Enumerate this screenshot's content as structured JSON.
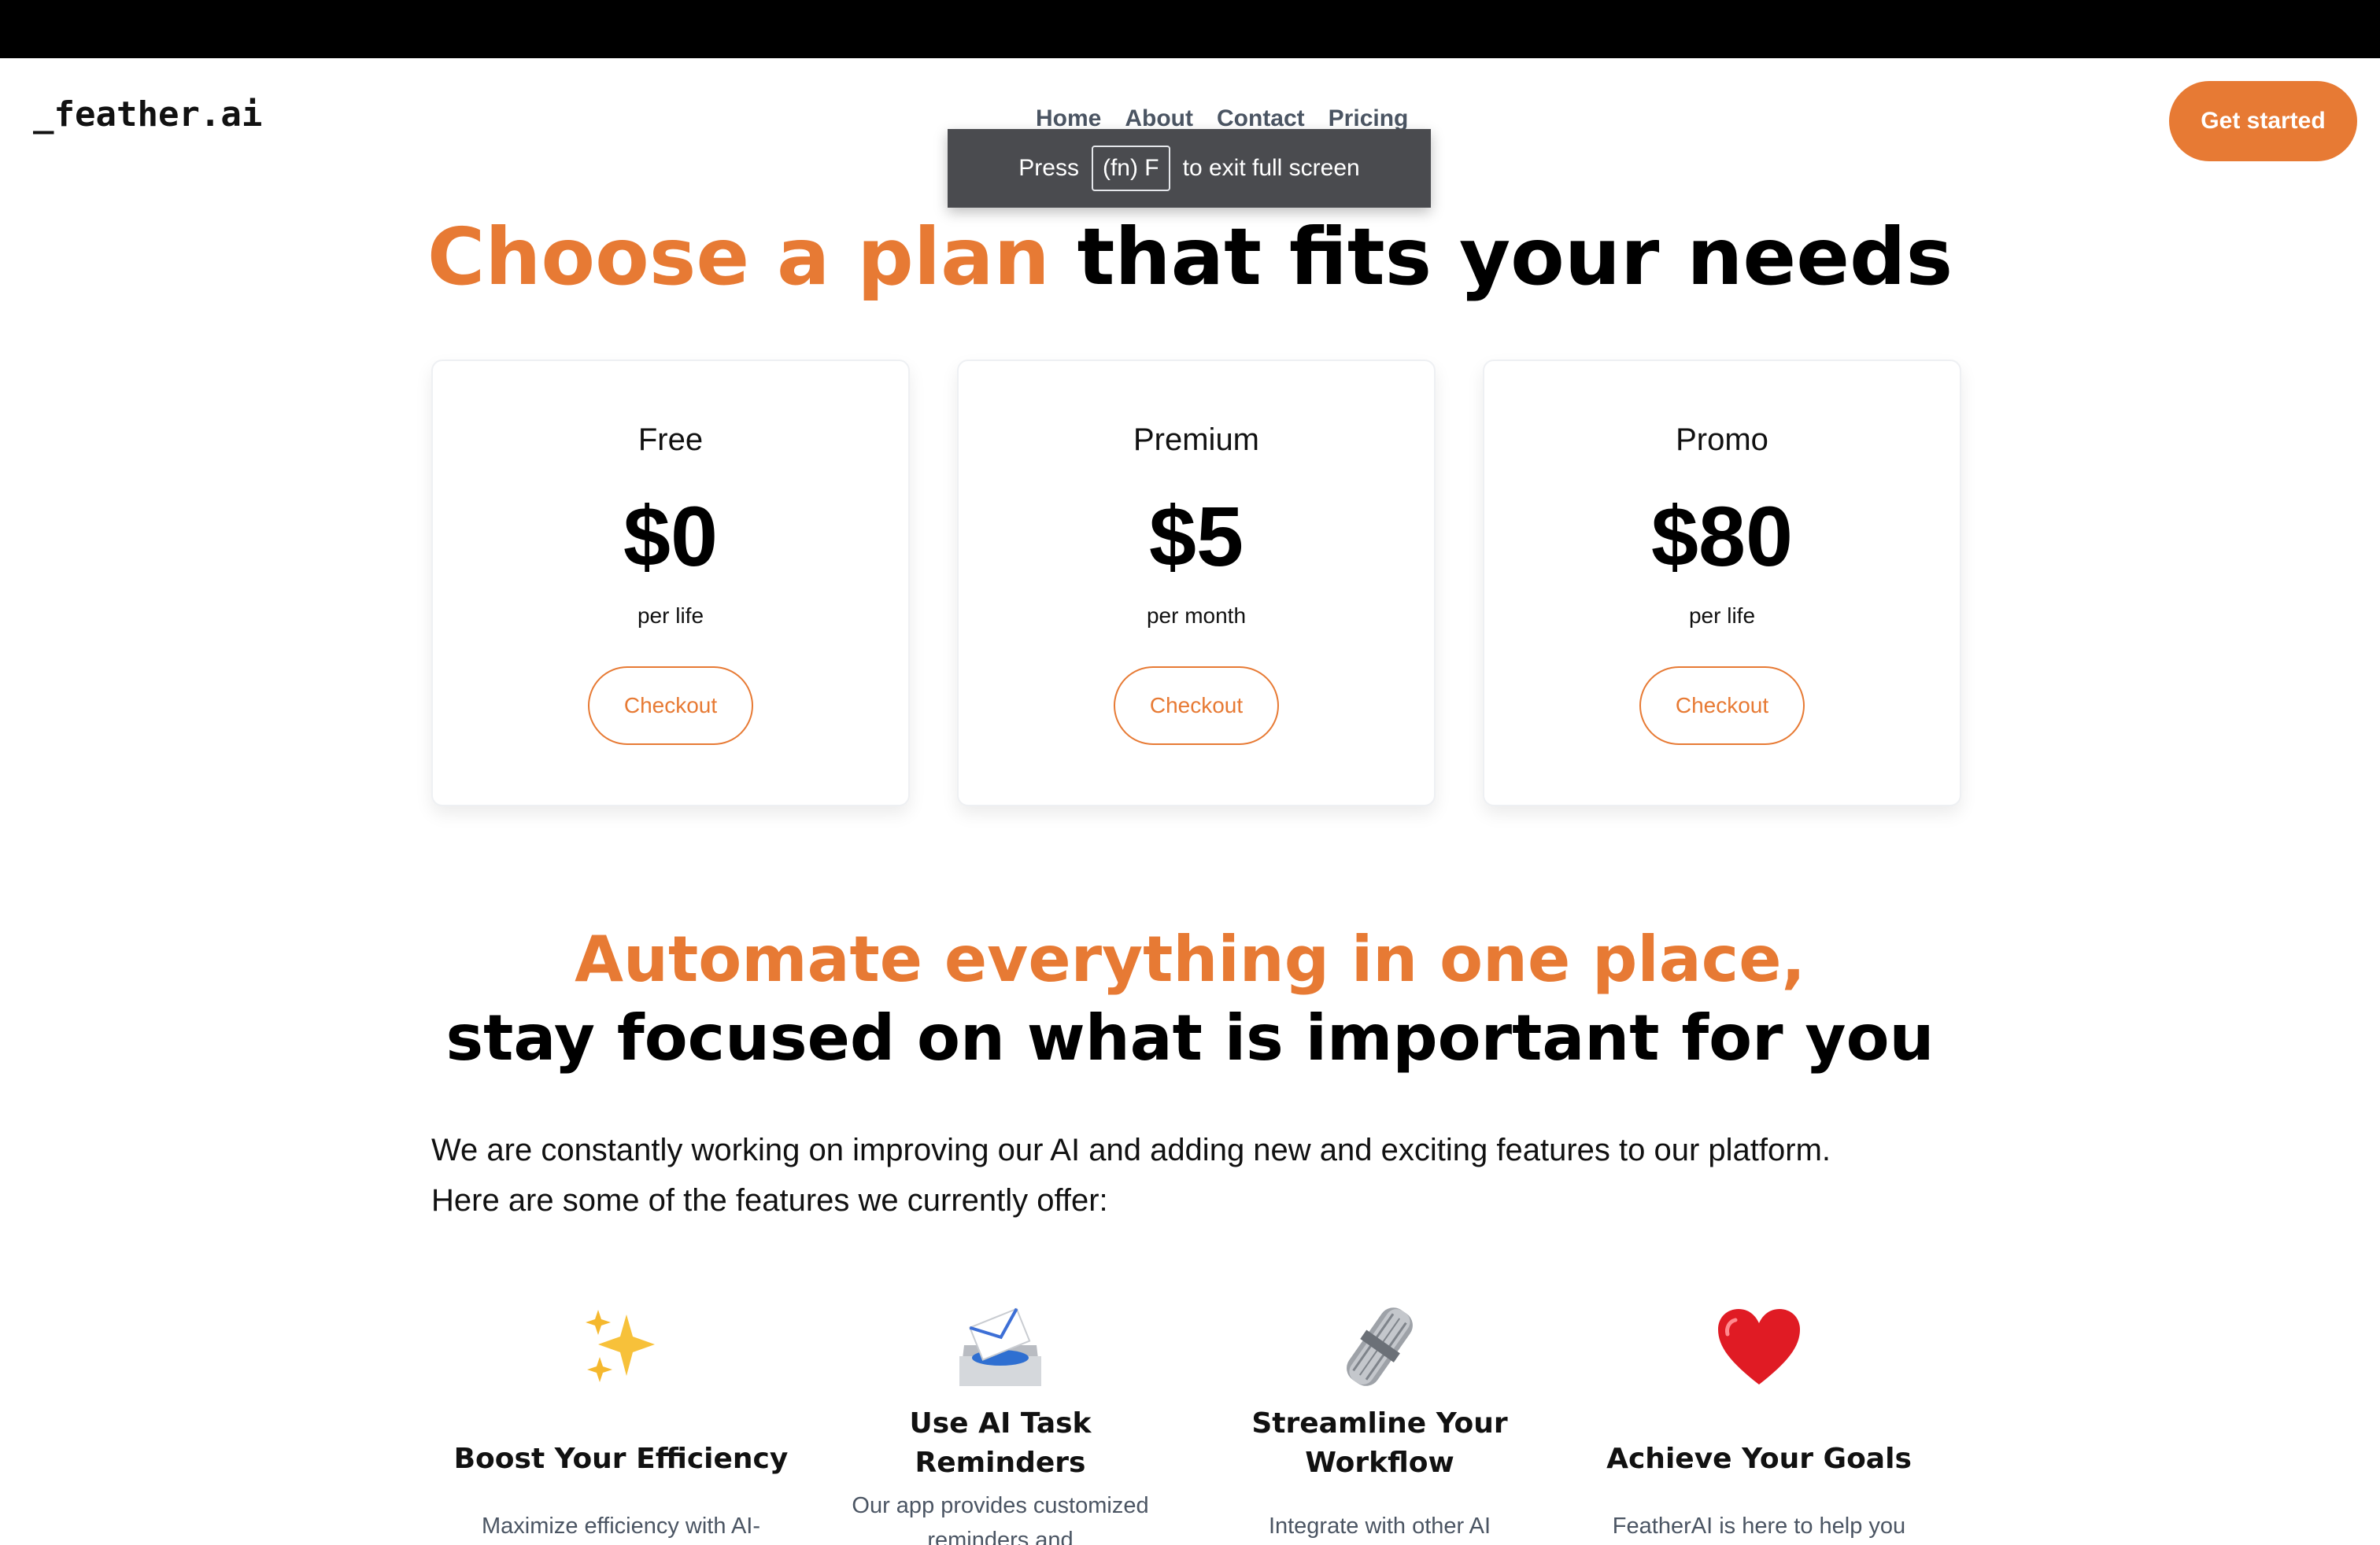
{
  "header": {
    "logo": "_feather.ai",
    "nav": [
      "Home",
      "About",
      "Contact",
      "Pricing"
    ],
    "cta": "Get started"
  },
  "fullscreen_toast": {
    "press": "Press",
    "key": "(fn) F",
    "suffix": "to exit full screen"
  },
  "pricing": {
    "title_accent": "Choose a plan",
    "title_rest": " that fits your needs",
    "plans": [
      {
        "name": "Free",
        "price": "$0",
        "period": "per life",
        "button": "Checkout"
      },
      {
        "name": "Premium",
        "price": "$5",
        "period": "per month",
        "button": "Checkout"
      },
      {
        "name": "Promo",
        "price": "$80",
        "period": "per life",
        "button": "Checkout"
      }
    ]
  },
  "automate": {
    "title_accent": "Automate everything in one place,",
    "title_rest": "stay focused on what is important for you",
    "intro_line1": "We are constantly working on improving our AI and adding new and exciting features to our platform.",
    "intro_line2": "Here are some of the features we currently offer:",
    "features": [
      {
        "icon": "sparkles-icon",
        "title": "Boost Your Efficiency",
        "desc": "Maximize efficiency with AI-"
      },
      {
        "icon": "inbox-envelope-icon",
        "title_line1": "Use AI Task",
        "title_line2": "Reminders",
        "desc": "Our app provides customized reminders and"
      },
      {
        "icon": "newspaper-roll-icon",
        "title_line1": "Streamline Your",
        "title_line2": "Workflow",
        "desc": "Integrate with other AI"
      },
      {
        "icon": "heart-icon",
        "title": "Achieve Your Goals",
        "desc": "FeatherAI is here to help you"
      }
    ]
  },
  "colors": {
    "accent": "#e77a34",
    "text": "#111111",
    "muted": "#4b5563",
    "topbar": "#000000",
    "toast": "#4a4b4f"
  }
}
